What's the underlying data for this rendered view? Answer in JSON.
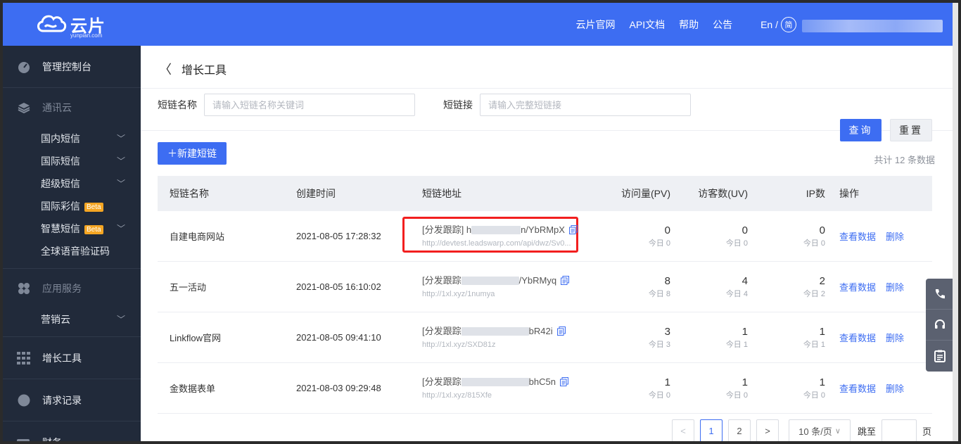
{
  "header": {
    "logo_text": "云片",
    "logo_sub": "yunpian.com",
    "nav": [
      "云片官网",
      "API文档",
      "帮助",
      "公告"
    ],
    "lang_label": "En /",
    "lang_circle": "简"
  },
  "sidebar": {
    "console": "管理控制台",
    "comm_cloud": "通讯云",
    "comm_items": [
      {
        "label": "国内短信",
        "has_chevron": true
      },
      {
        "label": "国际短信",
        "has_chevron": true
      },
      {
        "label": "超级短信",
        "has_chevron": true
      },
      {
        "label": "国际彩信",
        "badge": "Beta"
      },
      {
        "label": "智慧短信",
        "badge": "Beta",
        "has_chevron": true
      },
      {
        "label": "全球语音验证码"
      }
    ],
    "app_service": "应用服务",
    "app_items": [
      {
        "label": "营销云",
        "has_chevron": true
      }
    ],
    "growth_tools": "增长工具",
    "request_log": "请求记录",
    "finance": "财务"
  },
  "page": {
    "title": "增长工具",
    "filter_name_label": "短链名称",
    "filter_name_placeholder": "请输入短链名称关键词",
    "filter_link_label": "短链接",
    "filter_link_placeholder": "请输入完整短链接",
    "query_button": "查询",
    "reset_button": "重置",
    "new_button": "＋新建短链",
    "total_text": "共计 12 条数据"
  },
  "table": {
    "headers": [
      "短链名称",
      "创建时间",
      "短链地址",
      "访问量(PV)",
      "访客数(UV)",
      "IP数",
      "操作"
    ],
    "rows": [
      {
        "name": "自建电商网站",
        "time": "2021-08-05 17:28:32",
        "url_prefix": "[分发跟踪] h",
        "url_suffix": "n/YbRMpX",
        "dest": "http://devtest.leadswarp.com/api/dwz/Sv0...",
        "pv": "0",
        "pv_today": "今日 0",
        "uv": "0",
        "uv_today": "今日 0",
        "ip": "0",
        "ip_today": "今日 0"
      },
      {
        "name": "五一活动",
        "time": "2021-08-05 16:10:02",
        "url_prefix": "[分发跟踪",
        "url_suffix": "/YbRMyq",
        "dest": "http://1xl.xyz/1numya",
        "pv": "8",
        "pv_today": "今日 8",
        "uv": "4",
        "uv_today": "今日 4",
        "ip": "2",
        "ip_today": "今日 2"
      },
      {
        "name": "Linkflow官网",
        "time": "2021-08-05 09:41:10",
        "url_prefix": "[分发跟踪",
        "url_suffix": "bR42i",
        "dest": "http://1xl.xyz/SXD81z",
        "pv": "3",
        "pv_today": "今日 3",
        "uv": "1",
        "uv_today": "今日 1",
        "ip": "1",
        "ip_today": "今日 1"
      },
      {
        "name": "金数据表单",
        "time": "2021-08-03 09:29:48",
        "url_prefix": "[分发跟踪",
        "url_suffix": "bhC5n",
        "dest": "http://1xl.xyz/815Xfe",
        "pv": "1",
        "pv_today": "今日 0",
        "uv": "1",
        "uv_today": "今日 0",
        "ip": "1",
        "ip_today": "今日 0"
      }
    ],
    "op_view": "查看数据",
    "op_delete": "删除"
  },
  "pager": {
    "pages": [
      "1",
      "2"
    ],
    "prev": "<",
    "next": ">",
    "page_size": "10 条/页",
    "jump_label": "跳至",
    "page_unit": "页"
  },
  "colors": {
    "primary": "#3d6df2",
    "sidebar": "#212a3a",
    "highlight": "#f21f1f"
  }
}
